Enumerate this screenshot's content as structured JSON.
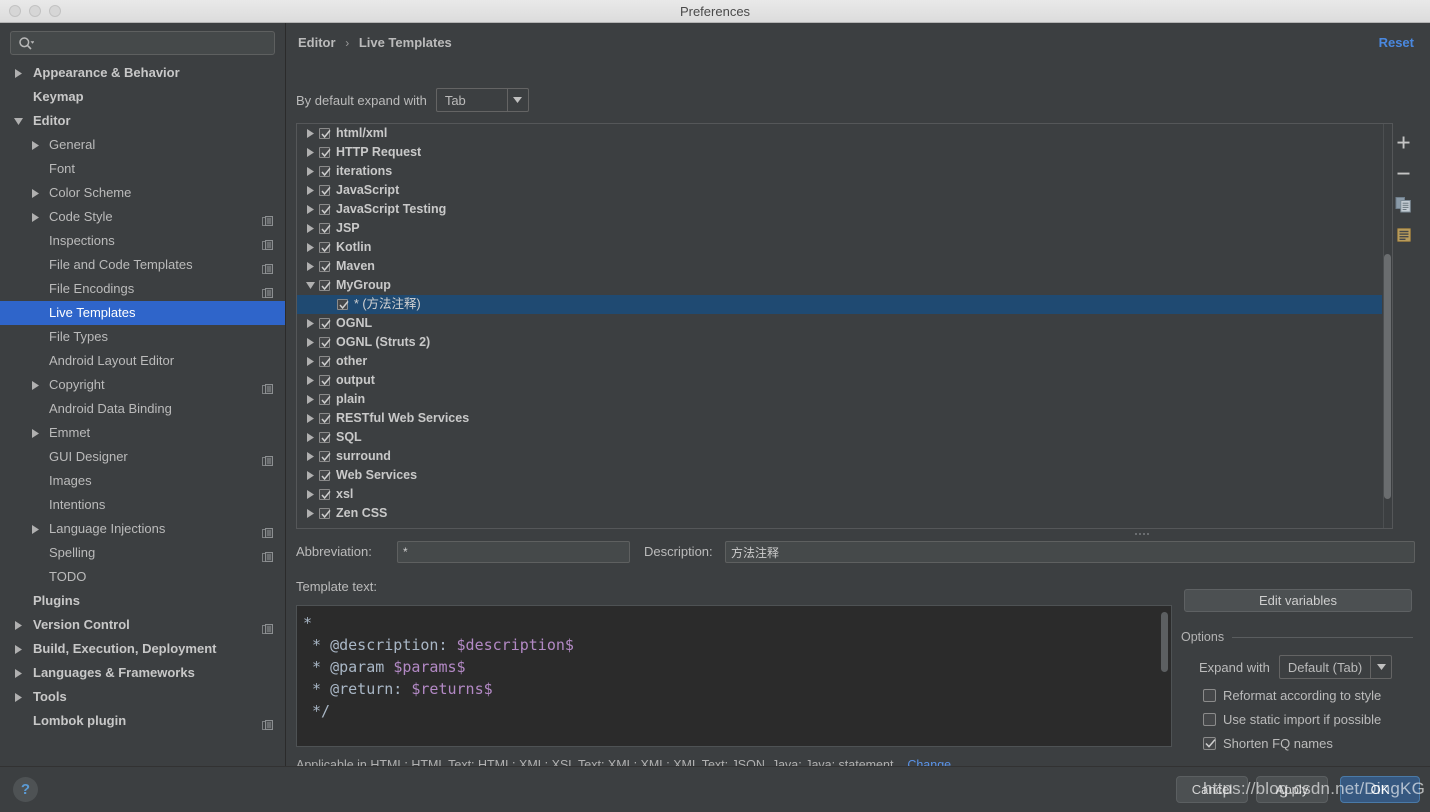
{
  "window": {
    "title": "Preferences",
    "traffic_lights": [
      "close",
      "minimize",
      "zoom"
    ]
  },
  "sidebar": {
    "search": {
      "value": "",
      "placeholder": ""
    },
    "items": [
      {
        "label": "Appearance & Behavior",
        "depth": 0,
        "arrow": "right",
        "bold": true,
        "selected": false,
        "badge": false
      },
      {
        "label": "Keymap",
        "depth": 0,
        "arrow": "none",
        "bold": true,
        "selected": false,
        "badge": false
      },
      {
        "label": "Editor",
        "depth": 0,
        "arrow": "down",
        "bold": true,
        "selected": false,
        "badge": false
      },
      {
        "label": "General",
        "depth": 1,
        "arrow": "right",
        "bold": false,
        "selected": false,
        "badge": false
      },
      {
        "label": "Font",
        "depth": 1,
        "arrow": "none",
        "bold": false,
        "selected": false,
        "badge": false
      },
      {
        "label": "Color Scheme",
        "depth": 1,
        "arrow": "right",
        "bold": false,
        "selected": false,
        "badge": false
      },
      {
        "label": "Code Style",
        "depth": 1,
        "arrow": "right",
        "bold": false,
        "selected": false,
        "badge": true
      },
      {
        "label": "Inspections",
        "depth": 1,
        "arrow": "none",
        "bold": false,
        "selected": false,
        "badge": true
      },
      {
        "label": "File and Code Templates",
        "depth": 1,
        "arrow": "none",
        "bold": false,
        "selected": false,
        "badge": true
      },
      {
        "label": "File Encodings",
        "depth": 1,
        "arrow": "none",
        "bold": false,
        "selected": false,
        "badge": true
      },
      {
        "label": "Live Templates",
        "depth": 1,
        "arrow": "none",
        "bold": false,
        "selected": true,
        "badge": false
      },
      {
        "label": "File Types",
        "depth": 1,
        "arrow": "none",
        "bold": false,
        "selected": false,
        "badge": false
      },
      {
        "label": "Android Layout Editor",
        "depth": 1,
        "arrow": "none",
        "bold": false,
        "selected": false,
        "badge": false
      },
      {
        "label": "Copyright",
        "depth": 1,
        "arrow": "right",
        "bold": false,
        "selected": false,
        "badge": true
      },
      {
        "label": "Android Data Binding",
        "depth": 1,
        "arrow": "none",
        "bold": false,
        "selected": false,
        "badge": false
      },
      {
        "label": "Emmet",
        "depth": 1,
        "arrow": "right",
        "bold": false,
        "selected": false,
        "badge": false
      },
      {
        "label": "GUI Designer",
        "depth": 1,
        "arrow": "none",
        "bold": false,
        "selected": false,
        "badge": true
      },
      {
        "label": "Images",
        "depth": 1,
        "arrow": "none",
        "bold": false,
        "selected": false,
        "badge": false
      },
      {
        "label": "Intentions",
        "depth": 1,
        "arrow": "none",
        "bold": false,
        "selected": false,
        "badge": false
      },
      {
        "label": "Language Injections",
        "depth": 1,
        "arrow": "right",
        "bold": false,
        "selected": false,
        "badge": true
      },
      {
        "label": "Spelling",
        "depth": 1,
        "arrow": "none",
        "bold": false,
        "selected": false,
        "badge": true
      },
      {
        "label": "TODO",
        "depth": 1,
        "arrow": "none",
        "bold": false,
        "selected": false,
        "badge": false
      },
      {
        "label": "Plugins",
        "depth": 0,
        "arrow": "none",
        "bold": true,
        "selected": false,
        "badge": false
      },
      {
        "label": "Version Control",
        "depth": 0,
        "arrow": "right",
        "bold": true,
        "selected": false,
        "badge": true
      },
      {
        "label": "Build, Execution, Deployment",
        "depth": 0,
        "arrow": "right",
        "bold": true,
        "selected": false,
        "badge": false
      },
      {
        "label": "Languages & Frameworks",
        "depth": 0,
        "arrow": "right",
        "bold": true,
        "selected": false,
        "badge": false
      },
      {
        "label": "Tools",
        "depth": 0,
        "arrow": "right",
        "bold": true,
        "selected": false,
        "badge": false
      },
      {
        "label": "Lombok plugin",
        "depth": 0,
        "arrow": "none",
        "bold": true,
        "selected": false,
        "badge": true
      }
    ]
  },
  "main": {
    "breadcrumb": {
      "parent": "Editor",
      "separator": "›",
      "current": "Live Templates"
    },
    "reset_label": "Reset",
    "expand_with": {
      "label": "By default expand with",
      "value": "Tab"
    },
    "template_tree": [
      {
        "label": "html/xml",
        "level": "group",
        "arrow": "right",
        "checked": true,
        "selected": false
      },
      {
        "label": "HTTP Request",
        "level": "group",
        "arrow": "right",
        "checked": true,
        "selected": false
      },
      {
        "label": "iterations",
        "level": "group",
        "arrow": "right",
        "checked": true,
        "selected": false
      },
      {
        "label": "JavaScript",
        "level": "group",
        "arrow": "right",
        "checked": true,
        "selected": false
      },
      {
        "label": "JavaScript Testing",
        "level": "group",
        "arrow": "right",
        "checked": true,
        "selected": false
      },
      {
        "label": "JSP",
        "level": "group",
        "arrow": "right",
        "checked": true,
        "selected": false
      },
      {
        "label": "Kotlin",
        "level": "group",
        "arrow": "right",
        "checked": true,
        "selected": false
      },
      {
        "label": "Maven",
        "level": "group",
        "arrow": "right",
        "checked": true,
        "selected": false
      },
      {
        "label": "MyGroup",
        "level": "group",
        "arrow": "down",
        "checked": true,
        "selected": false
      },
      {
        "label": "* (方法注释)",
        "level": "child",
        "arrow": "none",
        "checked": true,
        "selected": true
      },
      {
        "label": "OGNL",
        "level": "group",
        "arrow": "right",
        "checked": true,
        "selected": false
      },
      {
        "label": "OGNL (Struts 2)",
        "level": "group",
        "arrow": "right",
        "checked": true,
        "selected": false
      },
      {
        "label": "other",
        "level": "group",
        "arrow": "right",
        "checked": true,
        "selected": false
      },
      {
        "label": "output",
        "level": "group",
        "arrow": "right",
        "checked": true,
        "selected": false
      },
      {
        "label": "plain",
        "level": "group",
        "arrow": "right",
        "checked": true,
        "selected": false
      },
      {
        "label": "RESTful Web Services",
        "level": "group",
        "arrow": "right",
        "checked": true,
        "selected": false
      },
      {
        "label": "SQL",
        "level": "group",
        "arrow": "right",
        "checked": true,
        "selected": false
      },
      {
        "label": "surround",
        "level": "group",
        "arrow": "right",
        "checked": true,
        "selected": false
      },
      {
        "label": "Web Services",
        "level": "group",
        "arrow": "right",
        "checked": true,
        "selected": false
      },
      {
        "label": "xsl",
        "level": "group",
        "arrow": "right",
        "checked": true,
        "selected": false
      },
      {
        "label": "Zen CSS",
        "level": "group",
        "arrow": "right",
        "checked": true,
        "selected": false
      }
    ],
    "tree_toolbar": [
      {
        "icon": "plus-icon",
        "tooltip": "Add"
      },
      {
        "icon": "minus-icon",
        "tooltip": "Remove"
      },
      {
        "icon": "duplicate-icon",
        "tooltip": "Duplicate"
      },
      {
        "icon": "document-icon",
        "tooltip": "Change context"
      }
    ],
    "abbreviation": {
      "label": "Abbreviation:",
      "value": "*"
    },
    "description": {
      "label": "Description:",
      "value": "方法注释"
    },
    "template_text": {
      "label": "Template text:",
      "lines": [
        {
          "parts": [
            {
              "t": "*",
              "k": "plain"
            }
          ]
        },
        {
          "parts": [
            {
              "t": " * @description: ",
              "k": "plain"
            },
            {
              "t": "$description$",
              "k": "var"
            }
          ]
        },
        {
          "parts": [
            {
              "t": " * @param ",
              "k": "plain"
            },
            {
              "t": "$params$",
              "k": "var"
            }
          ]
        },
        {
          "parts": [
            {
              "t": " * @return: ",
              "k": "plain"
            },
            {
              "t": "$returns$",
              "k": "var"
            }
          ]
        },
        {
          "parts": [
            {
              "t": " */",
              "k": "plain"
            }
          ]
        }
      ]
    },
    "applicable": {
      "text": "Applicable in HTML: HTML Text; HTML; XML: XSL Text; XML; XML: XML Text; JSON, Java; Java: statement,...",
      "change_label": "Change"
    },
    "edit_variables_label": "Edit variables",
    "options": {
      "legend": "Options",
      "expand_with": {
        "label": "Expand with",
        "value": "Default (Tab)"
      },
      "checkboxes": [
        {
          "label": "Reformat according to style",
          "checked": false
        },
        {
          "label": "Use static import if possible",
          "checked": false
        },
        {
          "label": "Shorten FQ names",
          "checked": true
        }
      ]
    }
  },
  "footer": {
    "help_glyph": "?",
    "buttons": [
      {
        "id": "cancel",
        "label": "Cancel",
        "primary": false
      },
      {
        "id": "apply",
        "label": "Apply",
        "primary": false
      },
      {
        "id": "ok",
        "label": "OK",
        "primary": true
      }
    ]
  },
  "watermark": {
    "text": "https://blog.csdn.net/DingKG"
  },
  "colors": {
    "window_bg": "#3c3f41",
    "selection_blue": "#2f65ca",
    "tree_selection": "#1f4a72",
    "link_blue": "#4a88df",
    "primary_button": "#365880",
    "code_bg": "#2b2b2b",
    "code_variable": "#b389c5",
    "text": "#bbbbbb"
  }
}
